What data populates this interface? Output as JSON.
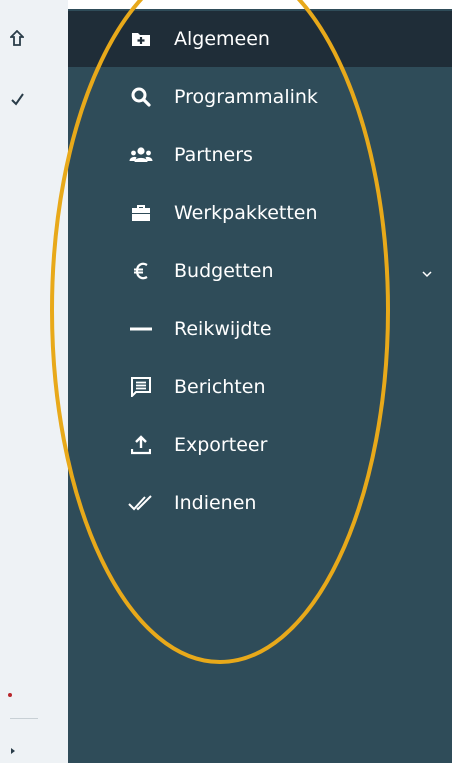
{
  "rail": {
    "icons": [
      "home-icon",
      "check-icon",
      "dot-icon",
      "caret-icon"
    ]
  },
  "sidebar": {
    "items": [
      {
        "label": "Algemeen",
        "icon": "folder-plus-icon",
        "active": true
      },
      {
        "label": "Programmalink",
        "icon": "search-icon"
      },
      {
        "label": "Partners",
        "icon": "users-icon"
      },
      {
        "label": "Werkpakketten",
        "icon": "briefcase-icon"
      },
      {
        "label": "Budgetten",
        "icon": "euro-icon",
        "expandable": true
      },
      {
        "label": "Reikwijdte",
        "icon": "dash-icon"
      },
      {
        "label": "Berichten",
        "icon": "message-icon"
      },
      {
        "label": "Exporteer",
        "icon": "upload-icon"
      },
      {
        "label": "Indienen",
        "icon": "double-check-icon"
      }
    ]
  },
  "colors": {
    "sidebar_bg": "#2f4c59",
    "active_bg": "#1f2d38",
    "annotation": "#e8a91a",
    "rail_bg": "#eef2f5"
  }
}
